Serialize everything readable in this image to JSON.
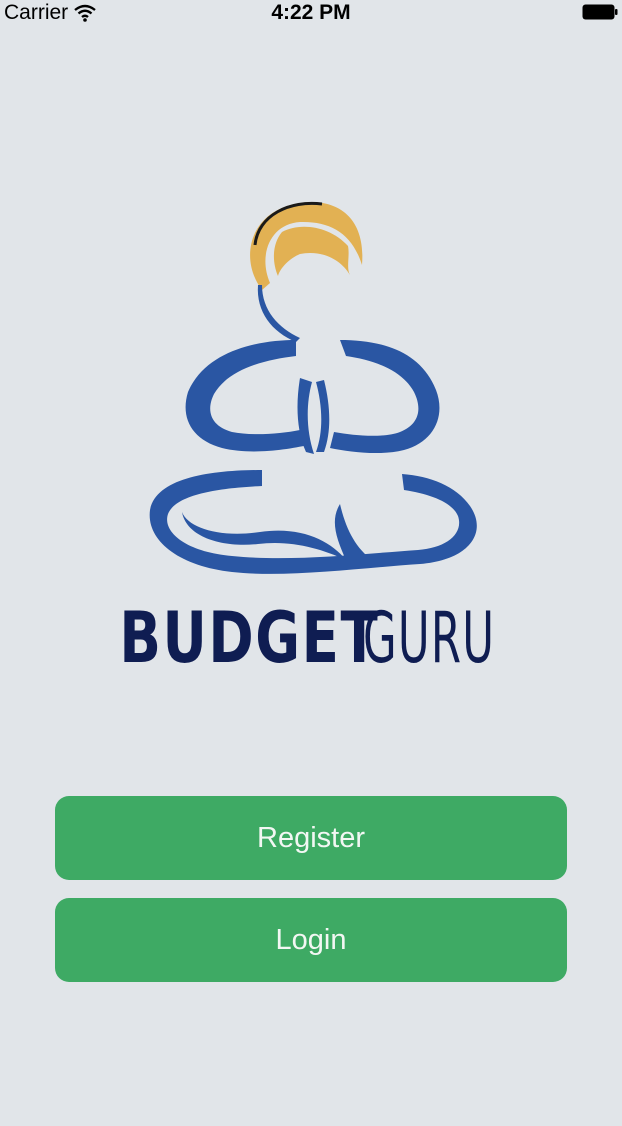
{
  "status_bar": {
    "carrier": "Carrier",
    "time": "4:22 PM",
    "wifi_icon": "wifi-icon",
    "battery_icon": "battery-icon"
  },
  "brand": {
    "name_bold": "BUDGET",
    "name_light": "GURU",
    "logo_icon": "meditating-guru-icon",
    "colors": {
      "body": "#2a56a3",
      "hair": "#e2b153",
      "text": "#0f1d52"
    }
  },
  "actions": {
    "register_label": "Register",
    "login_label": "Login",
    "button_color": "#3eaa64"
  }
}
